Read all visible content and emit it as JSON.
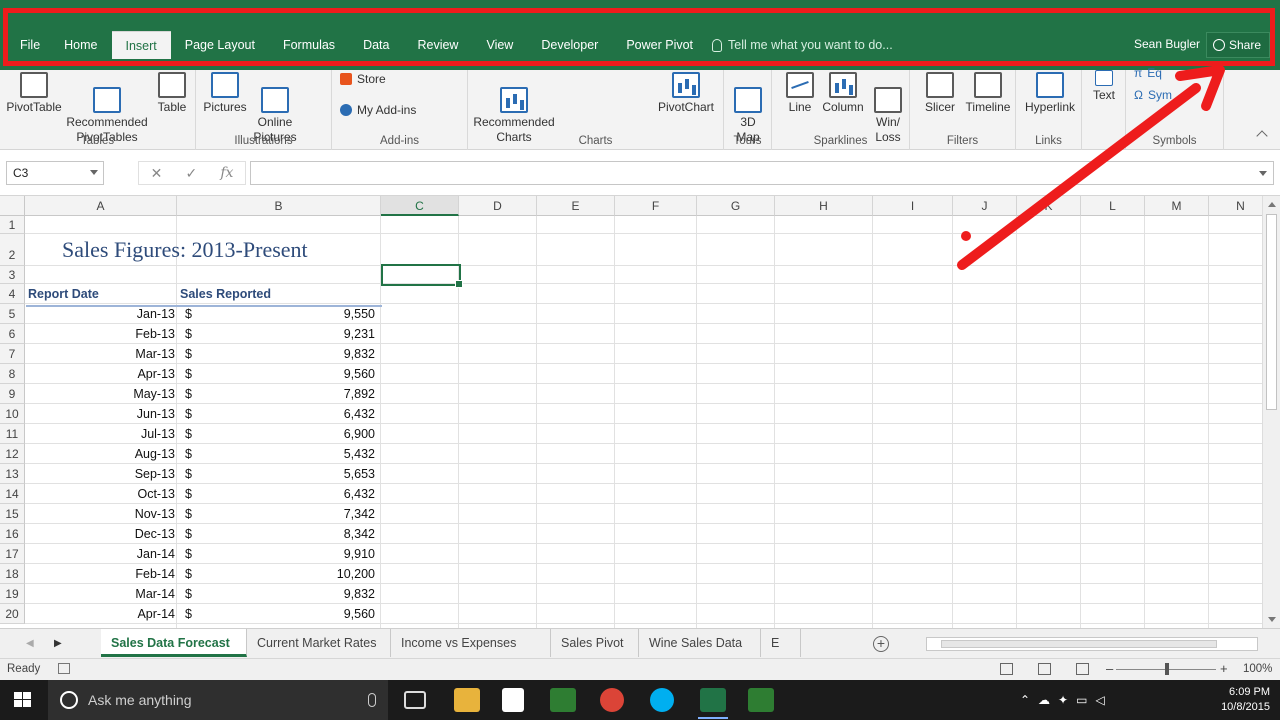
{
  "ribbon_tabs": [
    {
      "label": "File"
    },
    {
      "label": "Home"
    },
    {
      "label": "Insert",
      "active": true
    },
    {
      "label": "Page Layout"
    },
    {
      "label": "Formulas"
    },
    {
      "label": "Data"
    },
    {
      "label": "Review"
    },
    {
      "label": "View"
    },
    {
      "label": "Developer"
    },
    {
      "label": "Power Pivot"
    }
  ],
  "tell_me": "Tell me what you want to do...",
  "user_name": "Sean Bugler",
  "share_label": "Share",
  "groups": {
    "tables": {
      "label": "Tables",
      "pivottable": "PivotTable",
      "recommended_pivot": "Recommended\nPivotTables",
      "table": "Table"
    },
    "illustrations": {
      "label": "Illustrations",
      "pictures": "Pictures",
      "online_pictures": "Online\nPictures"
    },
    "addins": {
      "label": "Add-ins",
      "store": "Store",
      "my_addins": "My Add-ins"
    },
    "charts": {
      "label": "Charts",
      "recommended_charts": "Recommended\nCharts",
      "pivotchart": "PivotChart"
    },
    "tours": {
      "label": "Tours",
      "map3d": "3D\nMap"
    },
    "sparklines": {
      "label": "Sparklines",
      "line": "Line",
      "column": "Column",
      "winloss": "Win/\nLoss"
    },
    "filters": {
      "label": "Filters",
      "slicer": "Slicer",
      "timeline": "Timeline"
    },
    "links": {
      "label": "Links",
      "hyperlink": "Hyperlink"
    },
    "text": {
      "label": "",
      "text": "Text"
    },
    "symbols": {
      "label": "Symbols",
      "equation": "Eq",
      "symbol": "Sym"
    }
  },
  "name_box": "C3",
  "columns": [
    "A",
    "B",
    "C",
    "D",
    "E",
    "F",
    "G",
    "H",
    "I",
    "J",
    "K",
    "L",
    "M",
    "N"
  ],
  "rows": [
    "1",
    "2",
    "3",
    "4",
    "5",
    "6",
    "7",
    "8",
    "9",
    "10",
    "11",
    "12",
    "13",
    "14",
    "15",
    "16",
    "17",
    "18",
    "19",
    "20"
  ],
  "sheet": {
    "title": "Sales Figures: 2013-Present",
    "header_date": "Report Date",
    "header_sales": "Sales Reported",
    "currency": "$",
    "data": [
      {
        "date": "Jan-13",
        "sales": "9,550"
      },
      {
        "date": "Feb-13",
        "sales": "9,231"
      },
      {
        "date": "Mar-13",
        "sales": "9,832"
      },
      {
        "date": "Apr-13",
        "sales": "9,560"
      },
      {
        "date": "May-13",
        "sales": "7,892"
      },
      {
        "date": "Jun-13",
        "sales": "6,432"
      },
      {
        "date": "Jul-13",
        "sales": "6,900"
      },
      {
        "date": "Aug-13",
        "sales": "5,432"
      },
      {
        "date": "Sep-13",
        "sales": "5,653"
      },
      {
        "date": "Oct-13",
        "sales": "6,432"
      },
      {
        "date": "Nov-13",
        "sales": "7,342"
      },
      {
        "date": "Dec-13",
        "sales": "8,342"
      },
      {
        "date": "Jan-14",
        "sales": "9,910"
      },
      {
        "date": "Feb-14",
        "sales": "10,200"
      },
      {
        "date": "Mar-14",
        "sales": "9,832"
      },
      {
        "date": "Apr-14",
        "sales": "9,560"
      }
    ]
  },
  "sheet_tabs": [
    {
      "label": "Sales Data Forecast",
      "active": true
    },
    {
      "label": "Current Market Rates"
    },
    {
      "label": "Income vs Expenses Waterfall"
    },
    {
      "label": "Sales Pivot"
    },
    {
      "label": "Wine Sales Data"
    },
    {
      "label": "E ..."
    }
  ],
  "status": {
    "ready": "Ready",
    "zoom": "100%"
  },
  "taskbar": {
    "search_placeholder": "Ask me anything",
    "time": "6:09 PM",
    "date": "10/8/2015"
  },
  "colors": {
    "excel_green": "#217346",
    "annotation_red": "#ee1c1c"
  }
}
